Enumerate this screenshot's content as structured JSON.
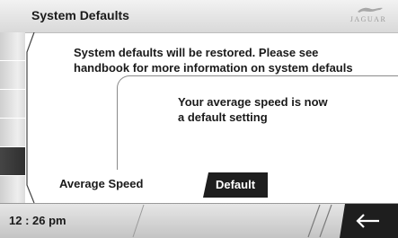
{
  "header": {
    "title": "System Defaults",
    "logo_text": "JAGUAR"
  },
  "main": {
    "message_line1": "System defaults will be restored. Please see",
    "message_line2": "handbook for more information on system defauls"
  },
  "popup": {
    "line1": "Your average speed is now",
    "line2": "a default setting"
  },
  "setting": {
    "label": "Average Speed",
    "button_label": "Default"
  },
  "footer": {
    "clock": "12 : 26 pm",
    "back_icon": "arrow-left-icon"
  },
  "side_tabs": [
    {
      "state": "normal"
    },
    {
      "state": "normal"
    },
    {
      "state": "normal"
    },
    {
      "state": "normal"
    },
    {
      "state": "active"
    },
    {
      "state": "normal"
    }
  ],
  "colors": {
    "button_bg": "#1e1e1e",
    "text": "#1a1a1a",
    "logo": "#9a9a9a"
  }
}
